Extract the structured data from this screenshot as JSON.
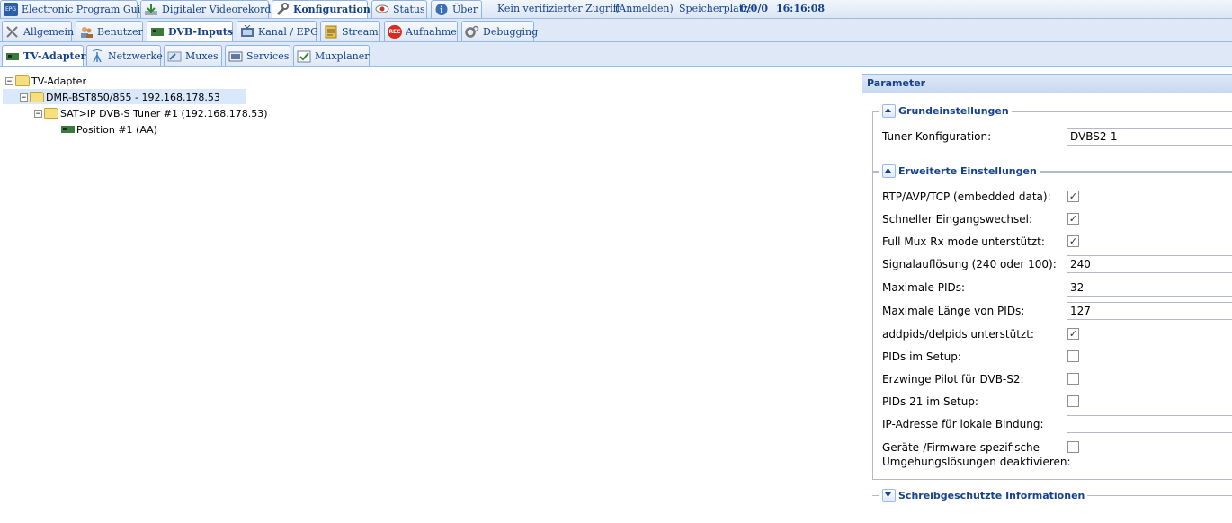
{
  "top_tabs": [
    {
      "label": "Electronic Program Guide",
      "icon": "epg-icon"
    },
    {
      "label": "Digitaler Videorekorder",
      "icon": "download-icon"
    },
    {
      "label": "Konfiguration",
      "icon": "wrench-icon",
      "active": true
    },
    {
      "label": "Status",
      "icon": "eye-icon"
    },
    {
      "label": "Über",
      "icon": "info-icon"
    }
  ],
  "status": {
    "access": "Kein verifizierter Zugriff",
    "login": "(Anmelden)",
    "storage_label": "Speicherplatz:",
    "storage_value": "0/0/0",
    "time": "16:16:08"
  },
  "config_tabs": [
    {
      "label": "Allgemein",
      "icon": "tools-icon"
    },
    {
      "label": "Benutzer",
      "icon": "users-icon"
    },
    {
      "label": "DVB-Inputs",
      "icon": "dvb-card-icon",
      "active": true
    },
    {
      "label": "Kanal / EPG",
      "icon": "tv-icon"
    },
    {
      "label": "Stream",
      "icon": "stream-icon"
    },
    {
      "label": "Aufnahme",
      "icon": "rec-icon",
      "icon_text": "REC"
    },
    {
      "label": "Debugging",
      "icon": "gears-icon"
    }
  ],
  "dvb_tabs": [
    {
      "label": "TV-Adapter",
      "icon": "card-icon",
      "active": true
    },
    {
      "label": "Netzwerke",
      "icon": "antenna-icon"
    },
    {
      "label": "Muxes",
      "icon": "satellite-icon"
    },
    {
      "label": "Services",
      "icon": "services-icon"
    },
    {
      "label": "Muxplaner",
      "icon": "planner-icon"
    }
  ],
  "tree": {
    "root": "TV-Adapter",
    "device": "DMR-BST850/855 - 192.168.178.53",
    "tuner": "SAT>IP DVB-S Tuner #1 (192.168.178.53)",
    "position": "Position #1 (AA)"
  },
  "panel": {
    "title": "Parameter",
    "basic": {
      "legend": "Grundeinstellungen",
      "tuner_config_label": "Tuner Konfiguration:",
      "tuner_config_value": "DVBS2-1"
    },
    "advanced": {
      "legend": "Erweiterte Einstellungen",
      "rtp_label": "RTP/AVP/TCP (embedded data):",
      "rtp_checked": true,
      "fast_input_label": "Schneller Eingangswechsel:",
      "fast_input_checked": true,
      "full_mux_label": "Full Mux Rx mode unterstützt:",
      "full_mux_checked": true,
      "signal_label": "Signalauflösung (240 oder 100):",
      "signal_value": "240",
      "max_pids_label": "Maximale PIDs:",
      "max_pids_value": "32",
      "max_pid_len_label": "Maximale Länge von PIDs:",
      "max_pid_len_value": "127",
      "addpids_label": "addpids/delpids unterstützt:",
      "addpids_checked": true,
      "pids_setup_label": "PIDs im Setup:",
      "pids_setup_checked": false,
      "pilot_label": "Erzwinge Pilot für DVB-S2:",
      "pilot_checked": false,
      "pids21_label": "PIDs 21 im Setup:",
      "pids21_checked": false,
      "ip_bind_label": "IP-Adresse für lokale Bindung:",
      "ip_bind_value": "",
      "workarounds_label_1": "Geräte-/Firmware-spezifische",
      "workarounds_label_2": "Umgehungslösungen deaktivieren:",
      "workarounds_checked": false
    },
    "readonly": {
      "legend": "Schreibgeschützte Informationen"
    }
  },
  "colors": {
    "accent": "#15428b",
    "tab_border": "#8db2e3",
    "bar_bg": "#dfe8f6"
  }
}
